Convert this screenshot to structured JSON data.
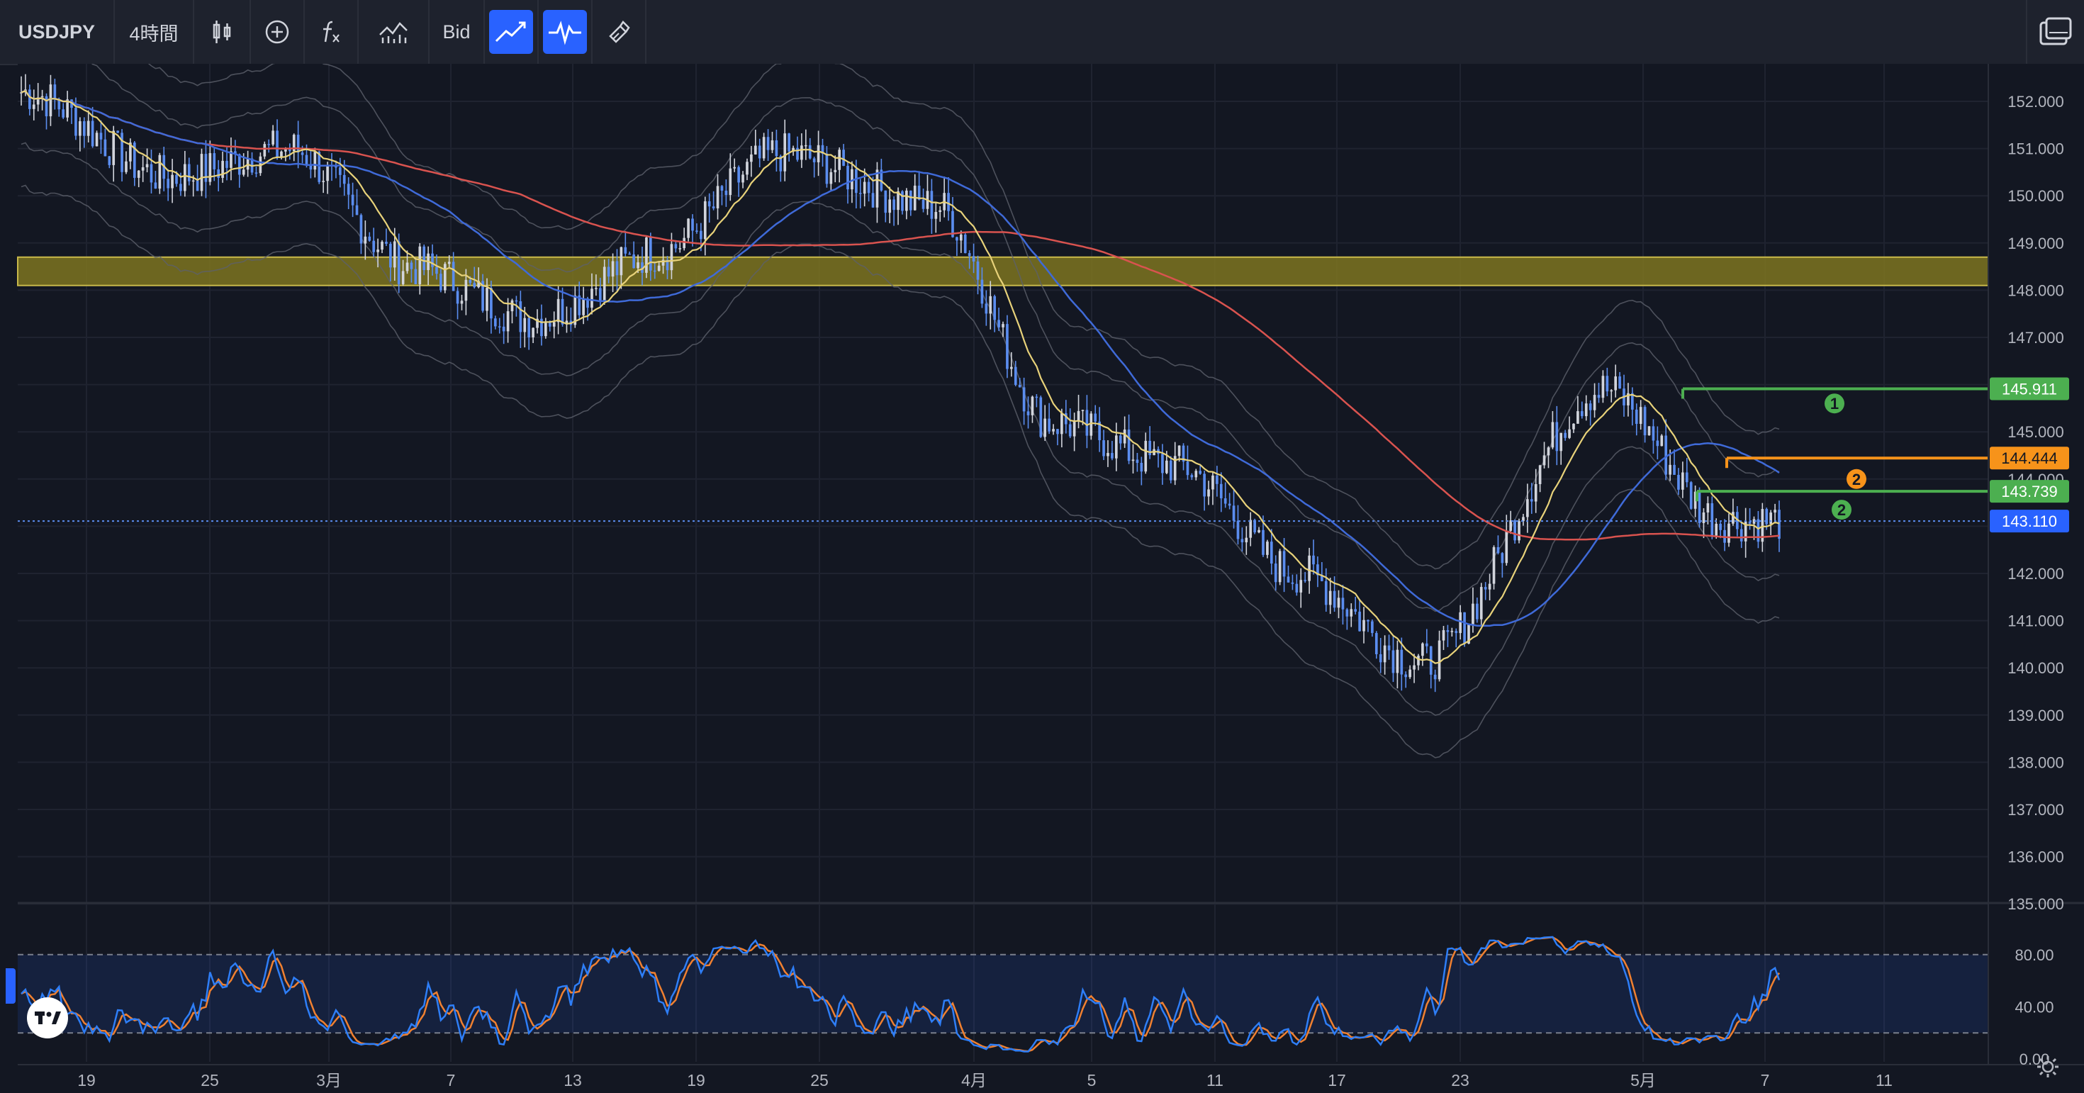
{
  "toolbar": {
    "symbol": "USDJPY",
    "interval": "4時間",
    "price_type": "Bid",
    "icons": [
      "candles-icon",
      "add-indicator-icon",
      "fx-icon",
      "compare-icon",
      "line-tool-icon",
      "oscillator-tool-icon",
      "brush-icon"
    ],
    "right_icon": "layout-icon"
  },
  "legend": {
    "collapse": "chevron-down-icon",
    "count": "6"
  },
  "colors": {
    "background": "#131722",
    "up": "#d1d4dc",
    "down": "#5b8def",
    "ma_short": "#e8d27a",
    "ma_mid": "#3f6ad8",
    "ma_long": "#d9534f",
    "zone": "#7e7420",
    "level_green": "#4caf50",
    "level_orange": "#f7931a",
    "last_price": "#2962ff",
    "stoch_k": "#2e7ef7",
    "stoch_d": "#f08030"
  },
  "price_axis": [
    "152.000",
    "151.000",
    "150.000",
    "149.000",
    "148.000",
    "147.000",
    "146.000",
    "145.000",
    "144.000",
    "143.000",
    "142.000",
    "141.000",
    "140.000",
    "139.000",
    "138.000",
    "137.000",
    "136.000",
    "135.000"
  ],
  "stoch_axis": [
    "80.00",
    "40.00",
    "0.00"
  ],
  "date_axis": [
    "19",
    "25",
    "3月",
    "7",
    "13",
    "19",
    "25",
    "4月",
    "5",
    "11",
    "17",
    "23",
    "5月",
    "7",
    "11"
  ],
  "price_tags": [
    {
      "label": "145.911",
      "color": "#4caf50"
    },
    {
      "label": "144.444",
      "color": "#f7931a"
    },
    {
      "label": "143.739",
      "color": "#4caf50"
    },
    {
      "label": "143.110",
      "color": "#2962ff"
    }
  ],
  "markers": [
    {
      "label": "1",
      "color": "#4caf50"
    },
    {
      "label": "2",
      "color": "#f7931a"
    },
    {
      "label": "2",
      "color": "#4caf50"
    }
  ],
  "chart_data": {
    "type": "candlestick",
    "symbol": "USDJPY",
    "interval": "4時間",
    "ylim": [
      135.0,
      152.4
    ],
    "x_categories": [
      "19",
      "25",
      "3月",
      "7",
      "13",
      "19",
      "25",
      "4月",
      "5",
      "11",
      "17",
      "23",
      "5月",
      "7",
      "11"
    ],
    "close_path": [
      {
        "date": "19",
        "value": 152.2
      },
      {
        "date": "25",
        "value": 150.4
      },
      {
        "date": "3月",
        "value": 151.0
      },
      {
        "date": "7",
        "value": 148.5
      },
      {
        "date": "13",
        "value": 147.4
      },
      {
        "date": "19",
        "value": 148.8
      },
      {
        "date": "25",
        "value": 150.9
      },
      {
        "date": "4月",
        "value": 149.8
      },
      {
        "date": "5",
        "value": 145.2
      },
      {
        "date": "11",
        "value": 144.3
      },
      {
        "date": "17",
        "value": 142.0
      },
      {
        "date": "23",
        "value": 140.1
      },
      {
        "date": "5月",
        "value": 145.9
      },
      {
        "date": "7",
        "value": 143.1
      }
    ],
    "resistance_zone": [
      148.1,
      148.7
    ],
    "levels": [
      145.911,
      144.444,
      143.739
    ],
    "last_price": 143.11,
    "stochastic": {
      "ylim": [
        0,
        100
      ],
      "bands": [
        20,
        80
      ]
    }
  }
}
